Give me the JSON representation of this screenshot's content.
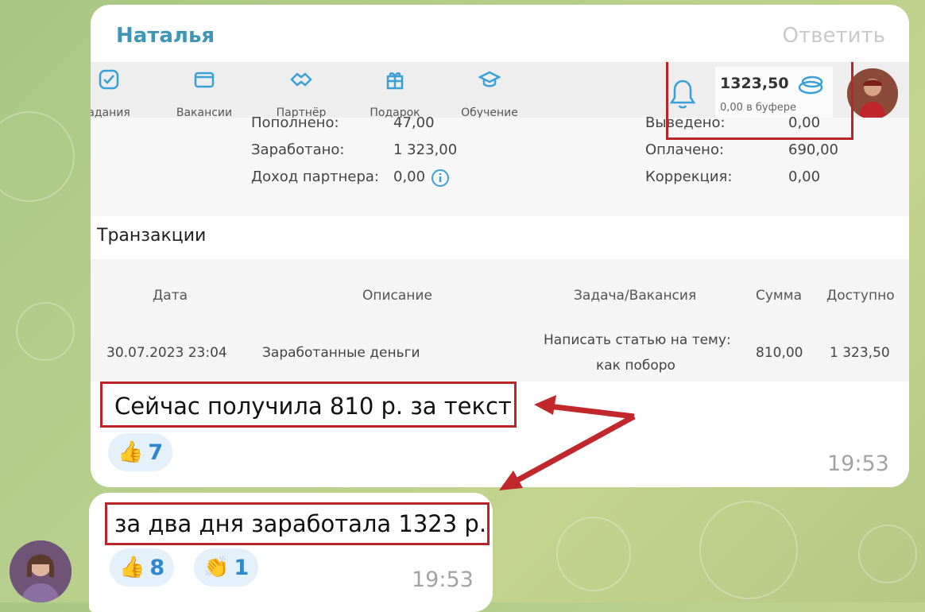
{
  "message1": {
    "sender": "Наталья",
    "reply_label": "Ответить",
    "screenshot": {
      "nav": [
        {
          "label": "адания",
          "icon": "check-icon"
        },
        {
          "label": "Вакансии",
          "icon": "envelope-icon"
        },
        {
          "label": "Партнёр",
          "icon": "handshake-icon"
        },
        {
          "label": "Подарок",
          "icon": "gift-icon"
        },
        {
          "label": "Обучение",
          "icon": "graduation-cap-icon"
        }
      ],
      "balance": {
        "amount": "1323,50",
        "buffer": "0,00 в буфере"
      },
      "stats_left": [
        {
          "label": "Пополнено:",
          "value": "47,00"
        },
        {
          "label": "Заработано:",
          "value": "1 323,00"
        },
        {
          "label": "Доход партнера:",
          "value": "0,00"
        }
      ],
      "stats_right": [
        {
          "label": "Выведено:",
          "value": "0,00"
        },
        {
          "label": "Оплачено:",
          "value": "690,00"
        },
        {
          "label": "Коррекция:",
          "value": "0,00"
        }
      ],
      "transactions_title": "Транзакции",
      "table": {
        "headers": [
          "Дата",
          "Описание",
          "Задача/Вакансия",
          "Сумма",
          "Доступно"
        ],
        "row": {
          "date": "30.07.2023 23:04",
          "description": "Заработанные деньги",
          "task_line1": "Написать статью на тему:",
          "task_line2": "как поборо",
          "amount": "810,00",
          "available": "1 323,50"
        }
      }
    },
    "text": "Сейчас получила 810 р. за текст",
    "reactions": [
      {
        "emoji": "👍",
        "count": "7"
      }
    ],
    "time": "19:53"
  },
  "message2": {
    "text": "за два дня заработала 1323 р.",
    "reactions": [
      {
        "emoji": "👍",
        "count": "8"
      },
      {
        "emoji": "👏",
        "count": "1"
      }
    ],
    "time": "19:53"
  },
  "colors": {
    "sender": "#3e95b5",
    "annotation": "#b8262a",
    "reaction_bg": "#e4f0fa",
    "reaction_count": "#2f88c9",
    "icon": "#3aa0d8"
  }
}
